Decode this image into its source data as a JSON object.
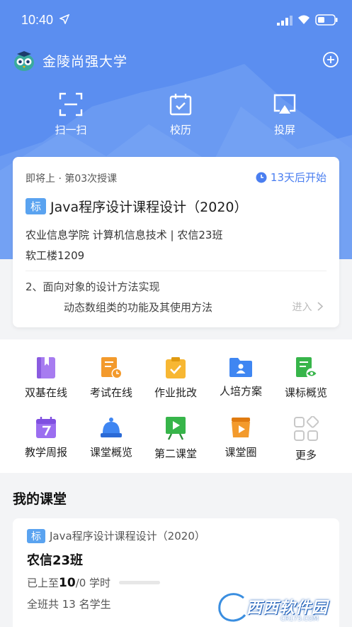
{
  "status_bar": {
    "time": "10:40"
  },
  "header": {
    "school_name": "金陵尚强大学"
  },
  "quick_actions": [
    {
      "label": "扫一扫",
      "icon": "scan-icon"
    },
    {
      "label": "校历",
      "icon": "calendar-icon"
    },
    {
      "label": "投屏",
      "icon": "cast-screen-icon"
    }
  ],
  "upcoming_class": {
    "status": "即将上 · 第03次授课",
    "countdown": "13天后开始",
    "tag": "标",
    "course_title": "Java程序设计课程设计（2020）",
    "department": "农业信息学院 计算机信息技术 | 农信23班",
    "room": "软工楼1209",
    "topic": "2、面向对象的设计方法实现",
    "subtopic": "动态数组类的功能及其使用方法",
    "enter_label": "进入"
  },
  "tools": [
    {
      "label": "双基在线",
      "icon": "book-icon",
      "color": "#a77cf0"
    },
    {
      "label": "考试在线",
      "icon": "exam-clock-icon",
      "color": "#f39a2c"
    },
    {
      "label": "作业批改",
      "icon": "clipboard-check-icon",
      "color": "#f7b733"
    },
    {
      "label": "人培方案",
      "icon": "folder-person-icon",
      "color": "#3f86f2"
    },
    {
      "label": "课标概览",
      "icon": "doc-eye-icon",
      "color": "#37b54a"
    },
    {
      "label": "教学周报",
      "icon": "calendar-seven-icon",
      "color": "#9b6ef0"
    },
    {
      "label": "课堂概览",
      "icon": "bell-classroom-icon",
      "color": "#3f86f2"
    },
    {
      "label": "第二课堂",
      "icon": "play-board-icon",
      "color": "#37b54a"
    },
    {
      "label": "课堂圈",
      "icon": "play-bag-icon",
      "color": "#f39a2c"
    },
    {
      "label": "更多",
      "icon": "more-grid-icon",
      "color": "#c8c8c8"
    }
  ],
  "my_classes": {
    "section_title": "我的课堂",
    "items": [
      {
        "tag": "标",
        "course_title": "Java程序设计课程设计（2020）",
        "class_name": "农信23班",
        "progress_prefix": "已上至",
        "progress_done": "10",
        "progress_rest": "/0 学时",
        "students": "全班共 13 名学生"
      }
    ]
  },
  "watermark": {
    "text": "西西软件园",
    "url": "CR173.COM"
  }
}
